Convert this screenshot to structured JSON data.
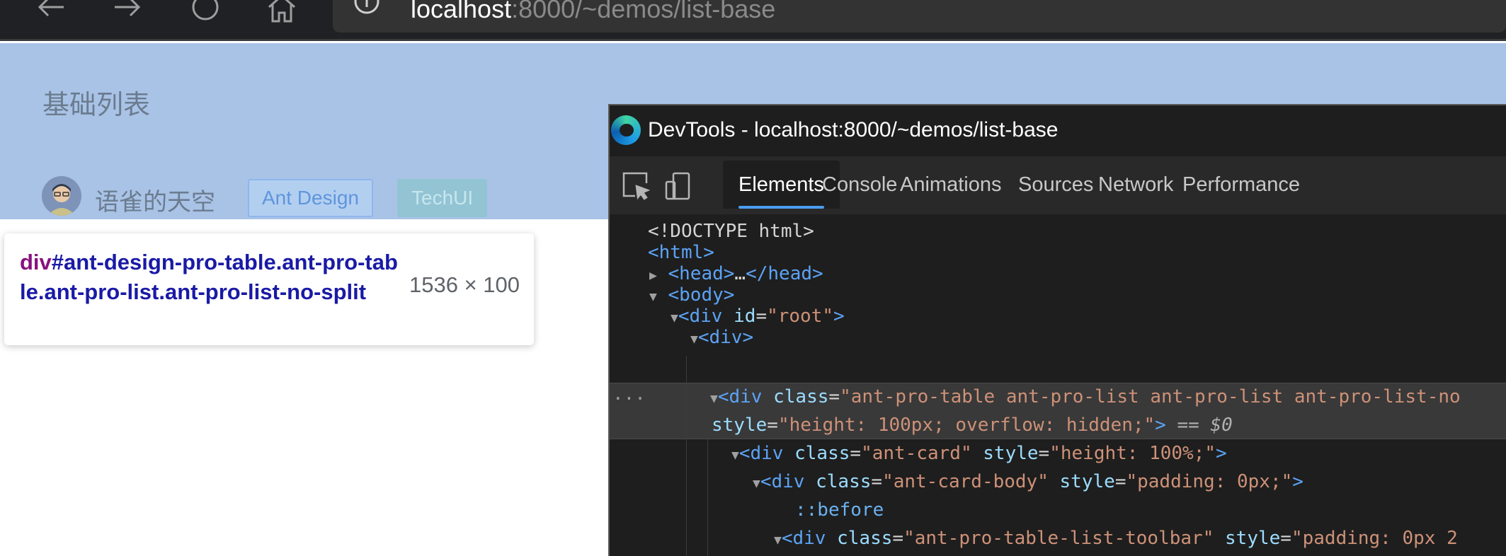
{
  "browser": {
    "address_host": "localhost",
    "address_path": ":8000/~demos/list-base",
    "nav_icons": [
      "back-arrow-icon",
      "forward-arrow-icon",
      "refresh-icon",
      "home-icon",
      "info-icon"
    ]
  },
  "page": {
    "title": "基础列表",
    "username": "语雀的天空",
    "tags": [
      "Ant Design",
      "TechUI"
    ],
    "highlight_color": "#a9c3e7"
  },
  "tooltip": {
    "tag": "div",
    "selector": "#ant-design-pro-table.ant-pro-table.ant-pro-list.ant-pro-list-no-split",
    "size": "1536 × 100"
  },
  "devtools": {
    "title": "DevTools - localhost:8000/~demos/list-base",
    "tabs": [
      "Elements",
      "Console",
      "Animations",
      "Sources",
      "Network",
      "Performance"
    ],
    "active_tab": "Elements",
    "dom": {
      "doctype": "<!DOCTYPE html>",
      "html_open": "<html>",
      "head_open": "<head>",
      "head_ellipsis": "…",
      "head_close": "</head>",
      "body_open": "<body>",
      "root_tag": "div",
      "root_attr": "id",
      "root_value": "\"root\"",
      "div_open": "<div>",
      "selected_tag": "div",
      "selected_class_attr": "class",
      "selected_class_value": "\"ant-pro-table ant-pro-list ant-pro-list ant-pro-list-no",
      "selected_style_attr": "style",
      "selected_style_value": "\"height: 100px; overflow: hidden;\"",
      "selected_marker": "== $0",
      "card_tag": "div",
      "card_class_value": "\"ant-card\"",
      "card_style_value": "\"height: 100%;\"",
      "cardbody_tag": "div",
      "cardbody_class_value": "\"ant-card-body\"",
      "cardbody_style_value": "\"padding: 0px;\"",
      "pseudo": "::before",
      "toolbar_tag": "div",
      "toolbar_class_value": "\"ant-pro-table-list-toolbar\"",
      "toolbar_style_value": "\"padding: 0px 2",
      "ellipsis": "···"
    }
  }
}
